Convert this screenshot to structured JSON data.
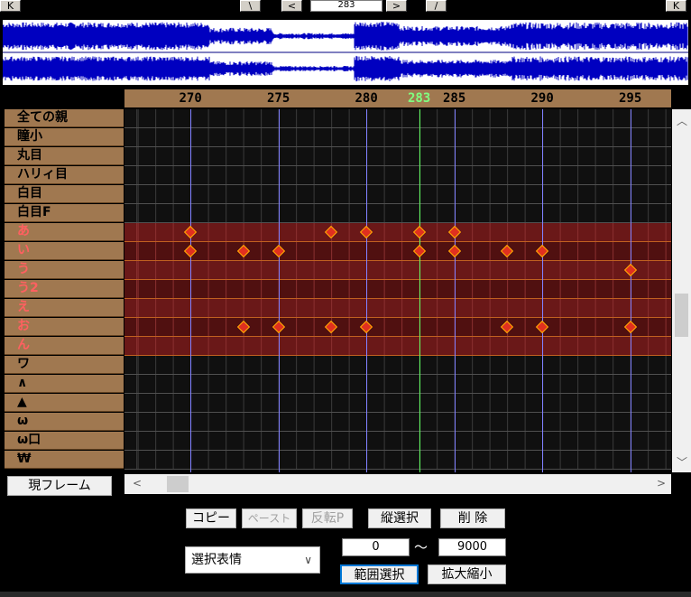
{
  "toolbar": {
    "first_btn": "K",
    "prev_key_btn": "\\",
    "prev_btn": "<",
    "frame_value": "283",
    "next_btn": ">",
    "next_key_btn": "/",
    "last_btn": "K"
  },
  "timeline": {
    "ruler_labels": [
      {
        "value": "270",
        "frame": 270,
        "current": false
      },
      {
        "value": "275",
        "frame": 275,
        "current": false
      },
      {
        "value": "280",
        "frame": 280,
        "current": false
      },
      {
        "value": "283",
        "frame": 283,
        "current": true
      },
      {
        "value": "285",
        "frame": 285,
        "current": false
      },
      {
        "value": "290",
        "frame": 290,
        "current": false
      },
      {
        "value": "295",
        "frame": 295,
        "current": false
      }
    ],
    "current_frame": 283,
    "rows": [
      {
        "label": "全ての親",
        "type": "bone",
        "keys": []
      },
      {
        "label": "瞳小",
        "type": "bone",
        "keys": []
      },
      {
        "label": "丸目",
        "type": "bone",
        "keys": []
      },
      {
        "label": "ハリィ目",
        "type": "bone",
        "keys": []
      },
      {
        "label": "白目",
        "type": "bone",
        "keys": []
      },
      {
        "label": "白目F",
        "type": "bone",
        "keys": []
      },
      {
        "label": "あ",
        "type": "morph",
        "keys": [
          270,
          278,
          280,
          283,
          285
        ]
      },
      {
        "label": "い",
        "type": "morph",
        "keys": [
          270,
          273,
          275,
          283,
          285,
          288,
          290
        ]
      },
      {
        "label": "う",
        "type": "morph",
        "keys": [
          295
        ]
      },
      {
        "label": "う2",
        "type": "morph",
        "keys": []
      },
      {
        "label": "え",
        "type": "morph",
        "keys": []
      },
      {
        "label": "お",
        "type": "morph",
        "keys": [
          273,
          275,
          278,
          280,
          288,
          290,
          295
        ]
      },
      {
        "label": "ん",
        "type": "morph",
        "keys": []
      },
      {
        "label": "ワ",
        "type": "bone",
        "keys": []
      },
      {
        "label": "∧",
        "type": "bone",
        "keys": []
      },
      {
        "label": "▲",
        "type": "bone",
        "keys": []
      },
      {
        "label": "ω",
        "type": "bone",
        "keys": []
      },
      {
        "label": "ω口",
        "type": "bone",
        "keys": []
      },
      {
        "label": "₩",
        "type": "bone",
        "keys": []
      }
    ]
  },
  "controls": {
    "current_frame_btn": "現フレーム",
    "copy": "コピー",
    "paste": "ペースト",
    "invert_paste": "反転P",
    "vertical_select": "縦選択",
    "delete": "削 除",
    "dropdown_value": "選択表情",
    "range_from": "0",
    "tilde": "～",
    "range_to": "9000",
    "range_select": "範囲選択",
    "scale": "拡大縮小"
  },
  "colors": {
    "keyframe": "#e03020",
    "current_line": "#60ff60",
    "major_line": "#8080ff",
    "label_bg": "#a07850",
    "morph_text": "#ff6060"
  }
}
